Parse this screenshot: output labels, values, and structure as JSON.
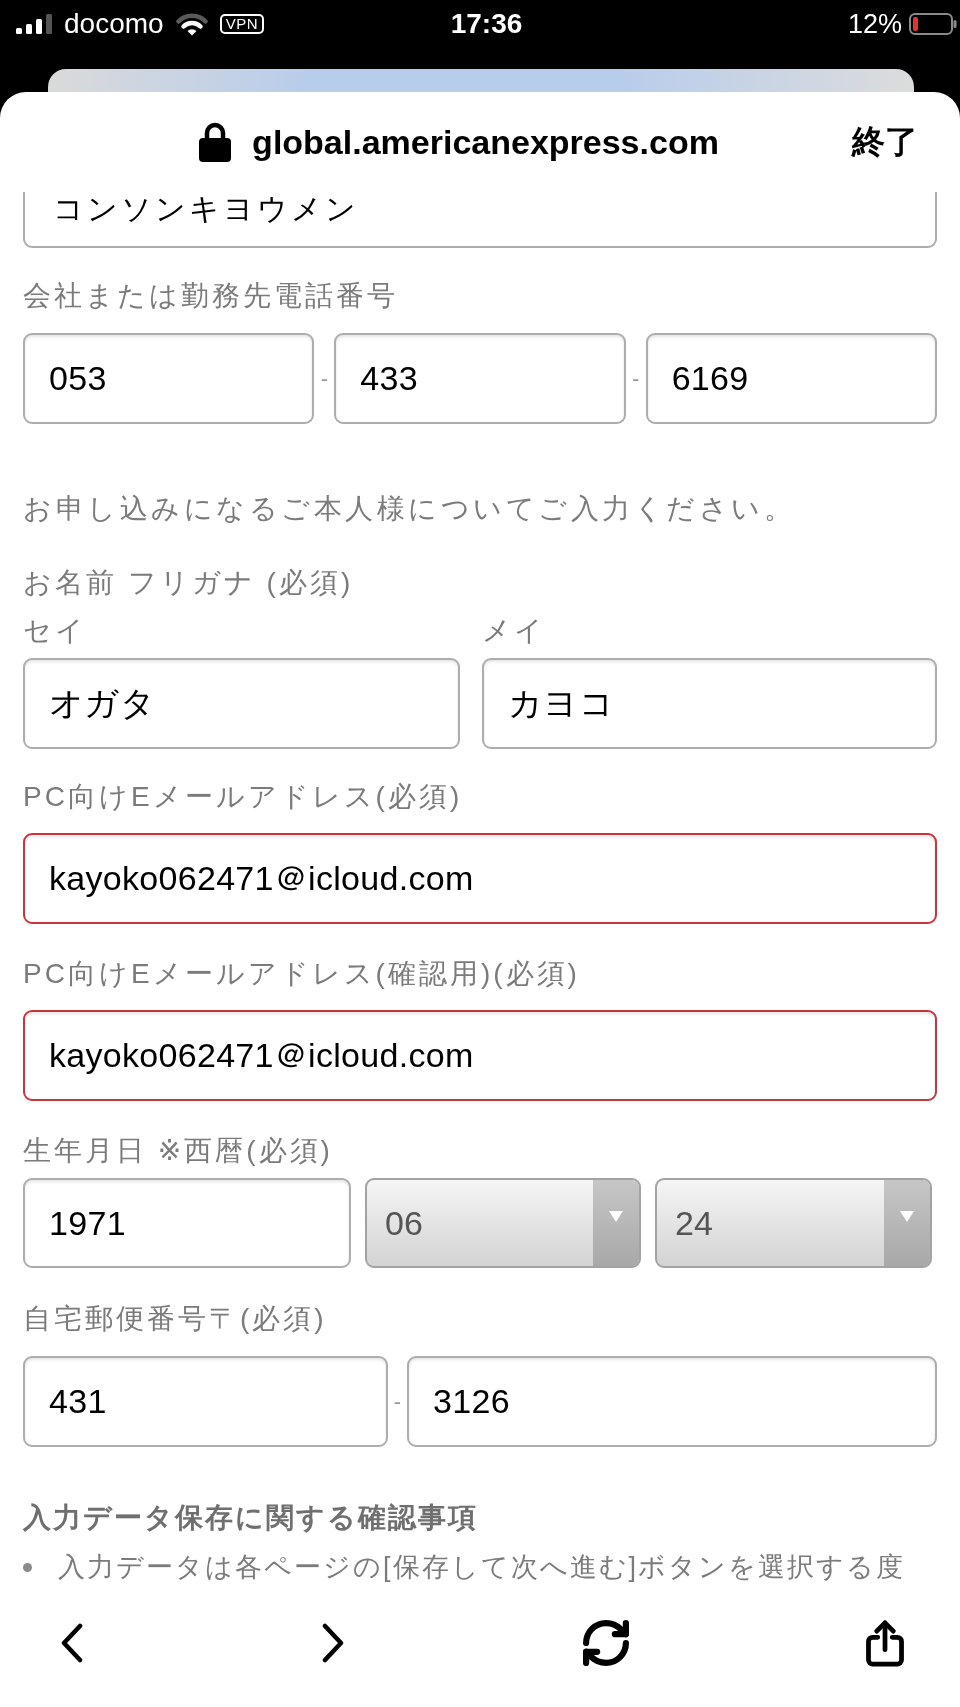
{
  "status_bar": {
    "carrier": "docomo",
    "vpn": "VPN",
    "time": "17:36",
    "battery": "12%"
  },
  "browser": {
    "url": "global.americanexpress.com",
    "done_button": "終了"
  },
  "form": {
    "partial_field": {
      "value": "コンソンキヨウメン"
    },
    "work_phone": {
      "label": "会社または勤務先電話番号",
      "fields": [
        {
          "value": "053"
        },
        {
          "separator": "-",
          "value": "433"
        },
        {
          "separator": "-",
          "value": "6169"
        }
      ]
    },
    "intro": "お申し込みになるご本人様についてご入力ください。",
    "name_kana": {
      "label": "お名前 フリガナ (必須)",
      "fields": [
        {
          "sublabel": "セイ",
          "value": "オガタ"
        },
        {
          "sublabel": "メイ",
          "value": "カヨコ"
        }
      ]
    },
    "email": {
      "label": "PC向けEメールアドレス(必須)",
      "value": "kayoko062471＠icloud.com",
      "error": true
    },
    "email_confirm": {
      "label": "PC向けEメールアドレス(確認用)(必須)",
      "value": "kayoko062471＠icloud.com",
      "error": true
    },
    "birth_date": {
      "label": "生年月日 ※西暦(必須)",
      "fields": [
        {
          "kind": "text",
          "value": "1971"
        },
        {
          "kind": "select",
          "value": "06"
        },
        {
          "kind": "select",
          "value": "24"
        }
      ]
    },
    "postal_code": {
      "label": "自宅郵便番号〒(必須)",
      "fields": [
        {
          "value": "431"
        },
        {
          "separator": "-",
          "value": "3126"
        }
      ]
    },
    "notice": {
      "title": "入力データ保存に関する確認事項",
      "items": [
        "入力データは各ページの[保存して次へ進む]ボタンを選択する度"
      ]
    }
  }
}
